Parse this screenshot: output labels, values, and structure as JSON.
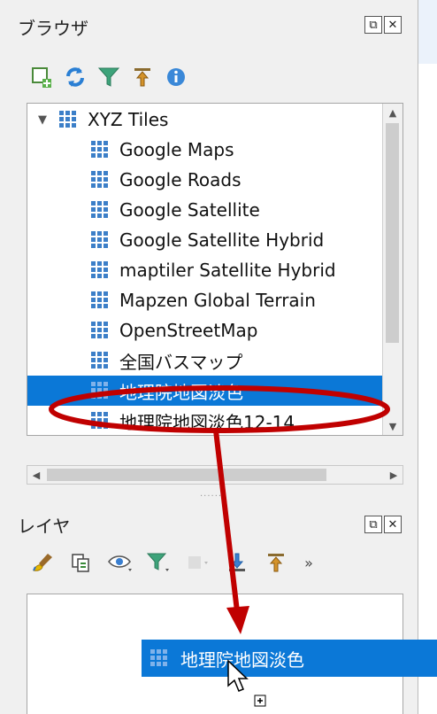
{
  "browser_panel": {
    "title": "ブラウザ",
    "float_button": "⧉",
    "close_button": "✕",
    "toolbar": [
      {
        "icon": "add-layer-icon"
      },
      {
        "icon": "refresh-icon"
      },
      {
        "icon": "filter-icon"
      },
      {
        "icon": "collapse-all-icon"
      },
      {
        "icon": "info-icon"
      }
    ],
    "tree": {
      "root": {
        "label": "XYZ Tiles",
        "expanded": true
      },
      "items": [
        {
          "label": "Google Maps",
          "selected": false
        },
        {
          "label": "Google Roads",
          "selected": false
        },
        {
          "label": "Google Satellite",
          "selected": false
        },
        {
          "label": "Google Satellite Hybrid",
          "selected": false
        },
        {
          "label": "maptiler Satellite Hybrid",
          "selected": false
        },
        {
          "label": "Mapzen Global Terrain",
          "selected": false
        },
        {
          "label": "OpenStreetMap",
          "selected": false
        },
        {
          "label": "全国バスマップ",
          "selected": false
        },
        {
          "label": "地理院地図淡色",
          "selected": true
        },
        {
          "label": "地理院地図淡色12-14",
          "selected": false
        }
      ]
    }
  },
  "layers_panel": {
    "title": "レイヤ",
    "float_button": "⧉",
    "close_button": "✕",
    "toolbar": [
      {
        "icon": "style-brush-icon"
      },
      {
        "icon": "add-group-icon"
      },
      {
        "icon": "visibility-eye-icon"
      },
      {
        "icon": "filter-legend-icon"
      },
      {
        "icon": "filter-expression-icon"
      },
      {
        "icon": "expand-all-icon"
      },
      {
        "icon": "collapse-all-icon"
      }
    ],
    "overflow": "»"
  },
  "drag_ghost": {
    "label": "地理院地図淡色"
  },
  "colors": {
    "selection": "#0b78d7",
    "annotation": "#c00000",
    "panel_bg": "#f0f0f0"
  }
}
